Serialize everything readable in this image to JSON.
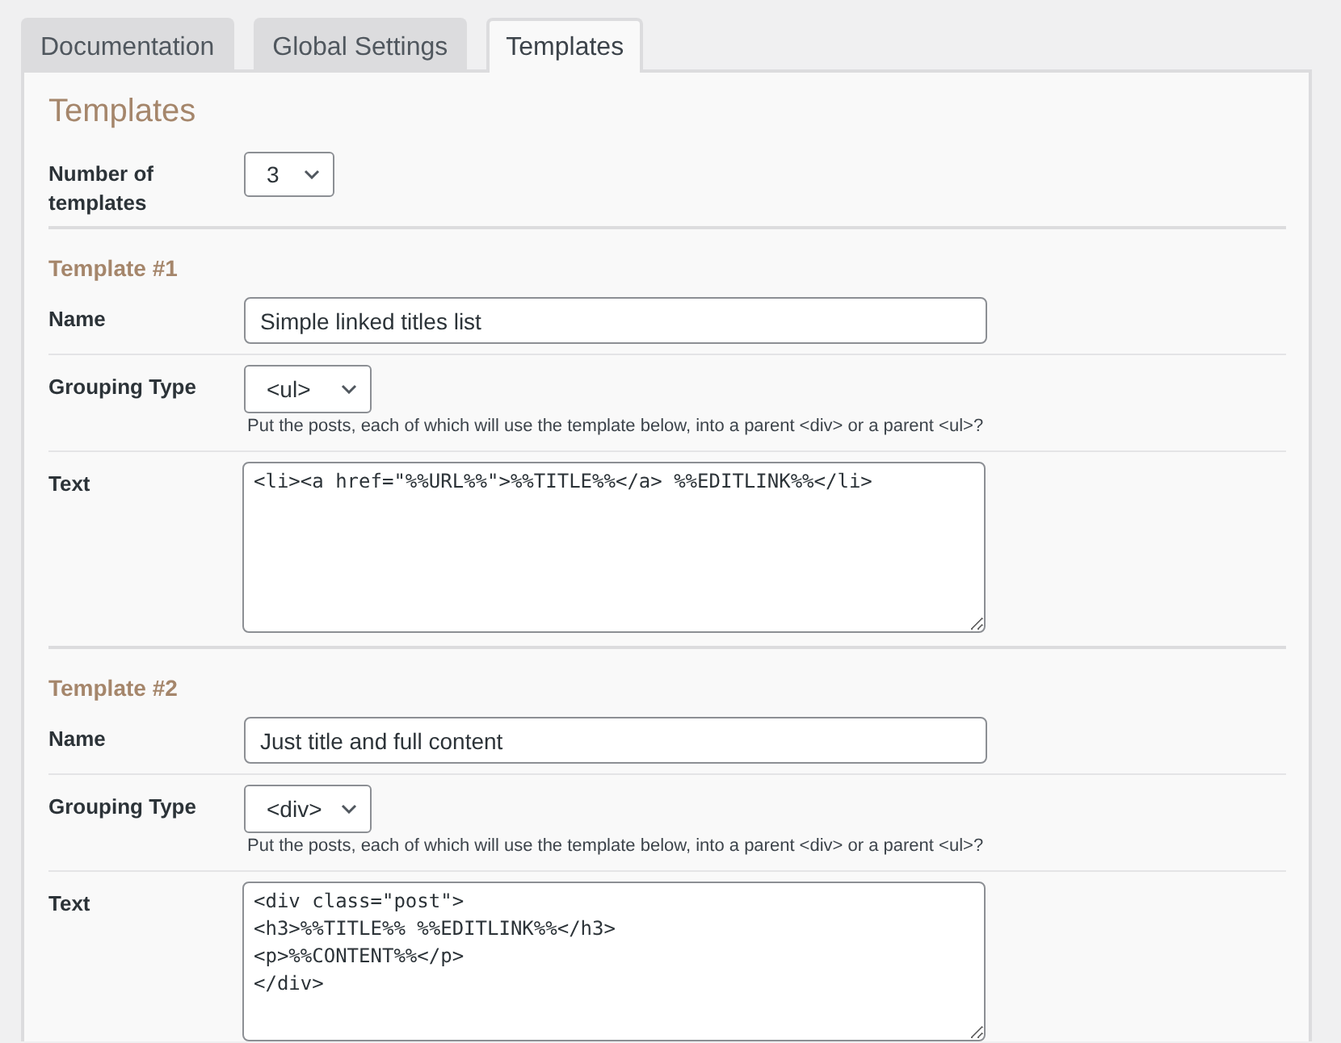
{
  "tabs": [
    {
      "label": "Documentation",
      "selected": false
    },
    {
      "label": "Global Settings",
      "selected": false
    },
    {
      "label": "Templates",
      "selected": true
    }
  ],
  "panel": {
    "title": "Templates",
    "fields": [
      {
        "kind": "select",
        "label": "Number of templates",
        "value": "3"
      }
    ]
  },
  "sections": [
    {
      "heading": "Template #1",
      "fields": [
        {
          "kind": "input",
          "label": "Name",
          "value": "Simple linked titles list"
        },
        {
          "kind": "select",
          "label": "Grouping Type",
          "value": "<ul>",
          "description": "Put the posts, each of which will use the template below, into a parent <div> or a parent <ul>?"
        },
        {
          "kind": "textarea",
          "label": "Text",
          "value": "<li><a href=\"%%URL%%\">%%TITLE%%</a> %%EDITLINK%%</li>"
        }
      ]
    },
    {
      "heading": "Template #2",
      "fields": [
        {
          "kind": "input",
          "label": "Name",
          "value": "Just title and full content"
        },
        {
          "kind": "select",
          "label": "Grouping Type",
          "value": "<div>",
          "description": "Put the posts, each of which will use the template below, into a parent <div> or a parent <ul>?"
        },
        {
          "kind": "textarea",
          "label": "Text",
          "value": "<div class=\"post\">\n<h3>%%TITLE%% %%EDITLINK%%</h3>\n<p>%%CONTENT%%</p>\n</div>"
        }
      ]
    }
  ]
}
